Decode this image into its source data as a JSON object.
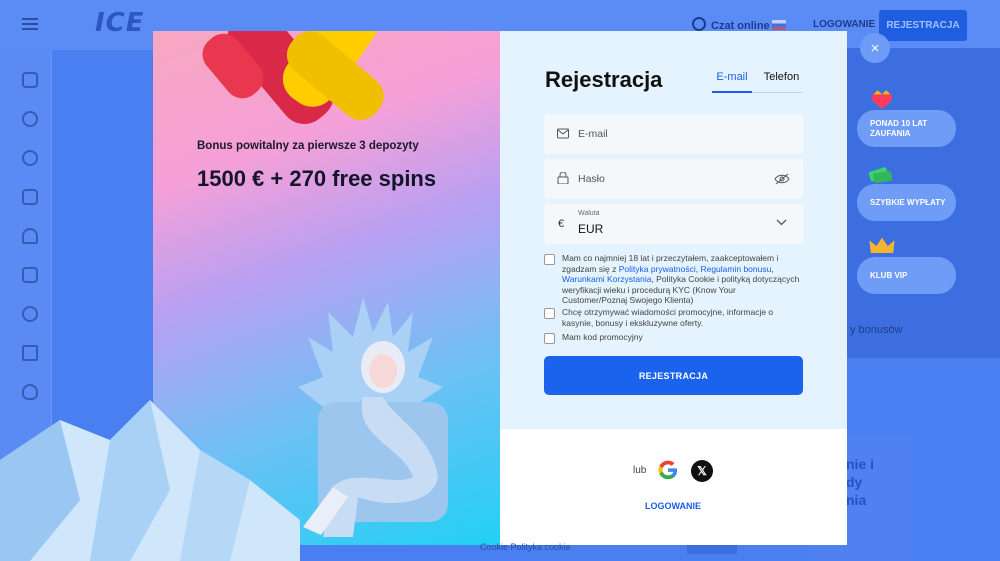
{
  "background": {
    "logo": "ICE",
    "chat_label": "Czat online",
    "login_label": "LOGOWANIE",
    "register_label": "REJESTRACJA",
    "bonus_text": "y bonusów",
    "bonus_heading": "nie i\ndy\nnia",
    "cookie_text": "Cookie  Polityka cookie"
  },
  "close_label": "×",
  "perks": [
    {
      "label": "PONAD 10 LAT ZAUFANIA"
    },
    {
      "label": "SZYBKIE WYPŁATY"
    },
    {
      "label": "KLUB VIP"
    }
  ],
  "promo": {
    "title": "Bonus powitalny za pierwsze 3 depozyty",
    "bonus": "1500 € + 270 free spins"
  },
  "form": {
    "title": "Rejestracja",
    "tabs": [
      {
        "label": "E-mail",
        "active": true
      },
      {
        "label": "Telefon",
        "active": false
      }
    ],
    "email_placeholder": "E-mail",
    "password_placeholder": "Hasło",
    "currency_label": "Waluta",
    "currency_symbol": "€",
    "currency_value": "EUR",
    "terms": {
      "part1": "Mam co najmniej 18 lat i przeczytałem, zaakceptowałem i zgadzam się z ",
      "link1": "Polityka prywatności",
      "sep1": ", ",
      "link2": "Regulamin bonusu",
      "sep2": ", ",
      "link3": "Warunkami Korzystania",
      "part2": ", Polityka Cookie i polityką dotyczących weryfikacji wieku i procedurą KYC (Know Your Customer/Poznaj Swojego Klienta)"
    },
    "marketing_text": "Chcę otrzymywać wiadomości promocyjne, informacje o kasynie, bonusy i ekskluzywne oferty.",
    "promo_code_text": "Mam kod promocyjny",
    "submit_label": "REJESTRACJA"
  },
  "social": {
    "or_label": "lub",
    "x_label": "𝕏",
    "login_label": "LOGOWANIE"
  }
}
